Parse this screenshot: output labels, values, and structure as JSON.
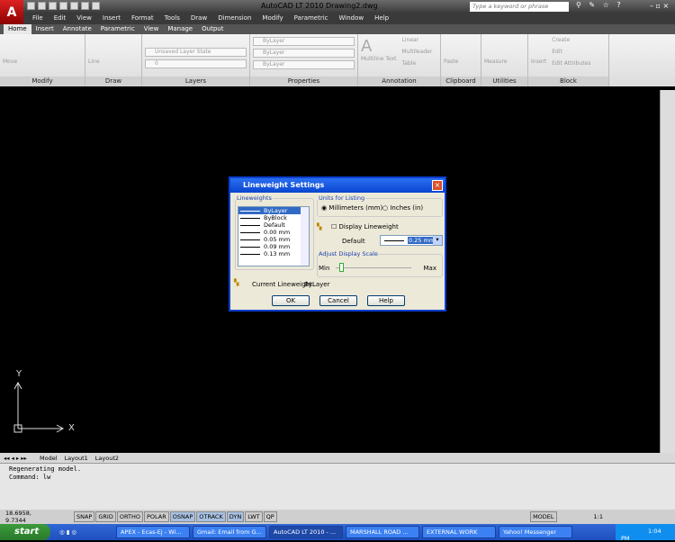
{
  "app": {
    "logo": "A",
    "title": "AutoCAD LT 2010    Drawing2.dwg",
    "search_placeholder": "Type a keyword or phrase",
    "help_icons": "⚲ ✎ ☆ ?",
    "window_controls": "– ▫ ×"
  },
  "menu": [
    "File",
    "Edit",
    "View",
    "Insert",
    "Format",
    "Tools",
    "Draw",
    "Dimension",
    "Modify",
    "Parametric",
    "Window",
    "Help"
  ],
  "ribbon_tabs": [
    "Home",
    "Insert",
    "Annotate",
    "Parametric",
    "View",
    "Manage",
    "Output"
  ],
  "panels": {
    "modify": {
      "label": "Modify",
      "move": "Move"
    },
    "draw": {
      "label": "Draw",
      "line": "Line"
    },
    "layers": {
      "label": "Layers",
      "layer_state": "Unsaved Layer State",
      "layer": "0"
    },
    "properties": {
      "label": "Properties",
      "color": "ByLayer",
      "lineweight": "ByLayer",
      "linetype": "ByLayer"
    },
    "annotation": {
      "label": "Annotation",
      "mtext": "Multiline Text",
      "linear": "Linear",
      "multileader": "Multileader",
      "table": "Table"
    },
    "clipboard": {
      "label": "Clipboard",
      "paste": "Paste"
    },
    "utilities": {
      "label": "Utilities",
      "measure": "Measure"
    },
    "block": {
      "label": "Block",
      "insert": "Insert",
      "create": "Create",
      "edit": "Edit",
      "edit_attributes": "Edit Attributes"
    }
  },
  "ucs": {
    "x": "X",
    "y": "Y"
  },
  "layout_tabs": [
    "Model",
    "Layout1",
    "Layout2"
  ],
  "command": {
    "lines": [
      "Regenerating model.",
      "Command: lw"
    ]
  },
  "status": {
    "coords": "18.6958, 9.7344",
    "toggles": [
      {
        "label": "SNAP",
        "on": false
      },
      {
        "label": "GRID",
        "on": false
      },
      {
        "label": "ORTHO",
        "on": false
      },
      {
        "label": "POLAR",
        "on": false
      },
      {
        "label": "OSNAP",
        "on": true
      },
      {
        "label": "OTRACK",
        "on": true
      },
      {
        "label": "DYN",
        "on": true
      },
      {
        "label": "LWT",
        "on": false
      },
      {
        "label": "QP",
        "on": false
      }
    ],
    "model": "MODEL",
    "scale": "1:1"
  },
  "taskbar": {
    "start": "start",
    "tasks": [
      {
        "label": "APEX - Ecas-Ej - Wi...",
        "active": false
      },
      {
        "label": "Gmail: Email from G...",
        "active": false
      },
      {
        "label": "AutoCAD LT 2010 - ...",
        "active": true
      },
      {
        "label": "MARSHALL ROAD ...",
        "active": false
      },
      {
        "label": "EXTERNAL WORK",
        "active": false
      },
      {
        "label": "Yahoo! Messenger",
        "active": false
      }
    ],
    "clock": "1:04 PM"
  },
  "dialog": {
    "title": "Lineweight Settings",
    "lineweights_legend": "Lineweights",
    "lineweights": [
      "ByLayer",
      "ByBlock",
      "Default",
      "0.00 mm",
      "0.05 mm",
      "0.09 mm",
      "0.13 mm"
    ],
    "selected": "ByLayer",
    "units_legend": "Units for Listing",
    "unit_mm": "Millimeters (mm)",
    "unit_in": "Inches (in)",
    "unit_selected": "mm",
    "display_lw": "Display Lineweight",
    "display_lw_checked": false,
    "default_label": "Default",
    "default_value": "0.25 mm",
    "scale_legend": "Adjust Display Scale",
    "min": "Min",
    "max": "Max",
    "scale_position": 0.05,
    "current_label": "Current Lineweight:",
    "current_value": "ByLayer",
    "ok": "OK",
    "cancel": "Cancel",
    "help": "Help"
  }
}
